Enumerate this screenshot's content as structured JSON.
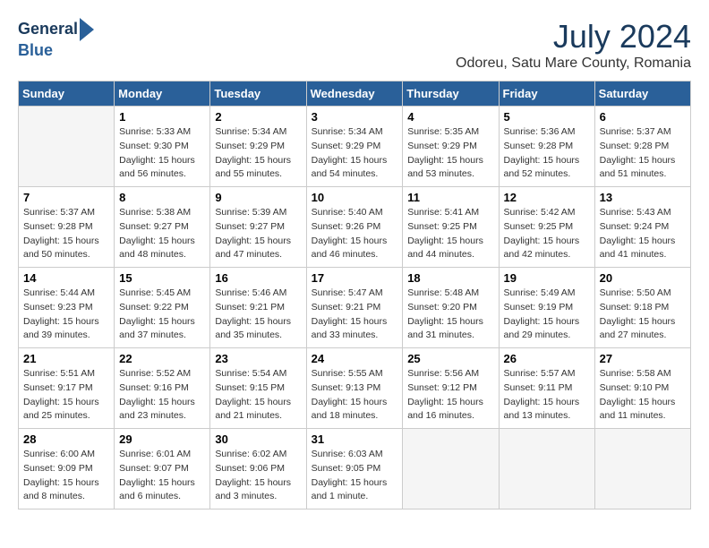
{
  "header": {
    "logo_line1": "General",
    "logo_line2": "Blue",
    "month_year": "July 2024",
    "location": "Odoreu, Satu Mare County, Romania"
  },
  "days_of_week": [
    "Sunday",
    "Monday",
    "Tuesday",
    "Wednesday",
    "Thursday",
    "Friday",
    "Saturday"
  ],
  "weeks": [
    [
      {
        "day": "",
        "info": ""
      },
      {
        "day": "1",
        "info": "Sunrise: 5:33 AM\nSunset: 9:30 PM\nDaylight: 15 hours\nand 56 minutes."
      },
      {
        "day": "2",
        "info": "Sunrise: 5:34 AM\nSunset: 9:29 PM\nDaylight: 15 hours\nand 55 minutes."
      },
      {
        "day": "3",
        "info": "Sunrise: 5:34 AM\nSunset: 9:29 PM\nDaylight: 15 hours\nand 54 minutes."
      },
      {
        "day": "4",
        "info": "Sunrise: 5:35 AM\nSunset: 9:29 PM\nDaylight: 15 hours\nand 53 minutes."
      },
      {
        "day": "5",
        "info": "Sunrise: 5:36 AM\nSunset: 9:28 PM\nDaylight: 15 hours\nand 52 minutes."
      },
      {
        "day": "6",
        "info": "Sunrise: 5:37 AM\nSunset: 9:28 PM\nDaylight: 15 hours\nand 51 minutes."
      }
    ],
    [
      {
        "day": "7",
        "info": "Sunrise: 5:37 AM\nSunset: 9:28 PM\nDaylight: 15 hours\nand 50 minutes."
      },
      {
        "day": "8",
        "info": "Sunrise: 5:38 AM\nSunset: 9:27 PM\nDaylight: 15 hours\nand 48 minutes."
      },
      {
        "day": "9",
        "info": "Sunrise: 5:39 AM\nSunset: 9:27 PM\nDaylight: 15 hours\nand 47 minutes."
      },
      {
        "day": "10",
        "info": "Sunrise: 5:40 AM\nSunset: 9:26 PM\nDaylight: 15 hours\nand 46 minutes."
      },
      {
        "day": "11",
        "info": "Sunrise: 5:41 AM\nSunset: 9:25 PM\nDaylight: 15 hours\nand 44 minutes."
      },
      {
        "day": "12",
        "info": "Sunrise: 5:42 AM\nSunset: 9:25 PM\nDaylight: 15 hours\nand 42 minutes."
      },
      {
        "day": "13",
        "info": "Sunrise: 5:43 AM\nSunset: 9:24 PM\nDaylight: 15 hours\nand 41 minutes."
      }
    ],
    [
      {
        "day": "14",
        "info": "Sunrise: 5:44 AM\nSunset: 9:23 PM\nDaylight: 15 hours\nand 39 minutes."
      },
      {
        "day": "15",
        "info": "Sunrise: 5:45 AM\nSunset: 9:22 PM\nDaylight: 15 hours\nand 37 minutes."
      },
      {
        "day": "16",
        "info": "Sunrise: 5:46 AM\nSunset: 9:21 PM\nDaylight: 15 hours\nand 35 minutes."
      },
      {
        "day": "17",
        "info": "Sunrise: 5:47 AM\nSunset: 9:21 PM\nDaylight: 15 hours\nand 33 minutes."
      },
      {
        "day": "18",
        "info": "Sunrise: 5:48 AM\nSunset: 9:20 PM\nDaylight: 15 hours\nand 31 minutes."
      },
      {
        "day": "19",
        "info": "Sunrise: 5:49 AM\nSunset: 9:19 PM\nDaylight: 15 hours\nand 29 minutes."
      },
      {
        "day": "20",
        "info": "Sunrise: 5:50 AM\nSunset: 9:18 PM\nDaylight: 15 hours\nand 27 minutes."
      }
    ],
    [
      {
        "day": "21",
        "info": "Sunrise: 5:51 AM\nSunset: 9:17 PM\nDaylight: 15 hours\nand 25 minutes."
      },
      {
        "day": "22",
        "info": "Sunrise: 5:52 AM\nSunset: 9:16 PM\nDaylight: 15 hours\nand 23 minutes."
      },
      {
        "day": "23",
        "info": "Sunrise: 5:54 AM\nSunset: 9:15 PM\nDaylight: 15 hours\nand 21 minutes."
      },
      {
        "day": "24",
        "info": "Sunrise: 5:55 AM\nSunset: 9:13 PM\nDaylight: 15 hours\nand 18 minutes."
      },
      {
        "day": "25",
        "info": "Sunrise: 5:56 AM\nSunset: 9:12 PM\nDaylight: 15 hours\nand 16 minutes."
      },
      {
        "day": "26",
        "info": "Sunrise: 5:57 AM\nSunset: 9:11 PM\nDaylight: 15 hours\nand 13 minutes."
      },
      {
        "day": "27",
        "info": "Sunrise: 5:58 AM\nSunset: 9:10 PM\nDaylight: 15 hours\nand 11 minutes."
      }
    ],
    [
      {
        "day": "28",
        "info": "Sunrise: 6:00 AM\nSunset: 9:09 PM\nDaylight: 15 hours\nand 8 minutes."
      },
      {
        "day": "29",
        "info": "Sunrise: 6:01 AM\nSunset: 9:07 PM\nDaylight: 15 hours\nand 6 minutes."
      },
      {
        "day": "30",
        "info": "Sunrise: 6:02 AM\nSunset: 9:06 PM\nDaylight: 15 hours\nand 3 minutes."
      },
      {
        "day": "31",
        "info": "Sunrise: 6:03 AM\nSunset: 9:05 PM\nDaylight: 15 hours\nand 1 minute."
      },
      {
        "day": "",
        "info": ""
      },
      {
        "day": "",
        "info": ""
      },
      {
        "day": "",
        "info": ""
      }
    ]
  ]
}
